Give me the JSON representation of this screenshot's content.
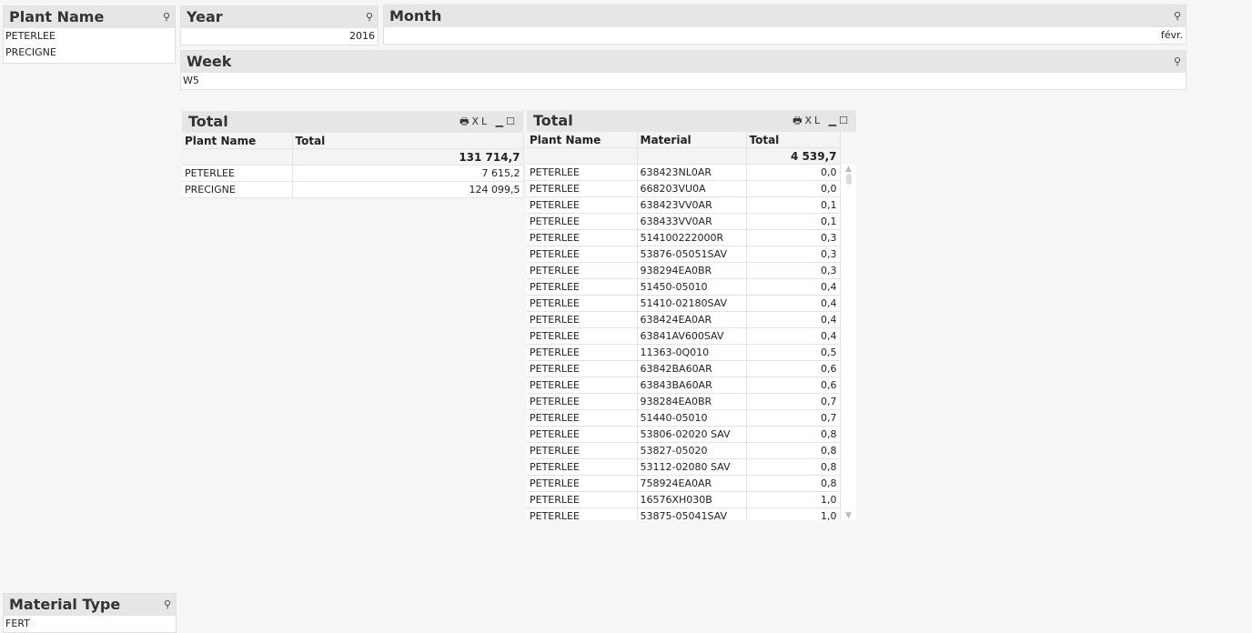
{
  "plant_listbox": {
    "title": "Plant Name",
    "items": [
      "PETERLEE",
      "PRECIGNE"
    ]
  },
  "year_listbox": {
    "title": "Year",
    "value": "2016"
  },
  "month_listbox": {
    "title": "Month",
    "value": "févr."
  },
  "week_listbox": {
    "title": "Week",
    "value": "W5"
  },
  "material_type_listbox": {
    "title": "Material Type",
    "value": "FERT"
  },
  "icons": {
    "search": "search-icon",
    "print": "print-icon",
    "xl": "XL",
    "minimize": "minimize-icon",
    "maximize": "maximize-icon"
  },
  "table1": {
    "title": "Total",
    "columns": [
      "Plant Name",
      "Total"
    ],
    "total": "131 714,7",
    "rows": [
      [
        "PETERLEE",
        "7 615,2"
      ],
      [
        "PRECIGNE",
        "124 099,5"
      ]
    ]
  },
  "table2": {
    "title": "Total",
    "columns": [
      "Plant Name",
      "Material",
      "Total"
    ],
    "total": "4 539,7",
    "rows": [
      [
        "PETERLEE",
        "638423NL0AR",
        "0,0"
      ],
      [
        "PETERLEE",
        "668203VU0A",
        "0,0"
      ],
      [
        "PETERLEE",
        "638423VV0AR",
        "0,1"
      ],
      [
        "PETERLEE",
        "638433VV0AR",
        "0,1"
      ],
      [
        "PETERLEE",
        "514100222000R",
        "0,3"
      ],
      [
        "PETERLEE",
        "53876-05051SAV",
        "0,3"
      ],
      [
        "PETERLEE",
        "938294EA0BR",
        "0,3"
      ],
      [
        "PETERLEE",
        "51450-05010",
        "0,4"
      ],
      [
        "PETERLEE",
        "51410-02180SAV",
        "0,4"
      ],
      [
        "PETERLEE",
        "638424EA0AR",
        "0,4"
      ],
      [
        "PETERLEE",
        "63841AV600SAV",
        "0,4"
      ],
      [
        "PETERLEE",
        "11363-0Q010",
        "0,5"
      ],
      [
        "PETERLEE",
        "63842BA60AR",
        "0,6"
      ],
      [
        "PETERLEE",
        "63843BA60AR",
        "0,6"
      ],
      [
        "PETERLEE",
        "938284EA0BR",
        "0,7"
      ],
      [
        "PETERLEE",
        "51440-05010",
        "0,7"
      ],
      [
        "PETERLEE",
        "53806-02020 SAV",
        "0,8"
      ],
      [
        "PETERLEE",
        "53827-05020",
        "0,8"
      ],
      [
        "PETERLEE",
        "53112-02080 SAV",
        "0,8"
      ],
      [
        "PETERLEE",
        "758924EA0AR",
        "0,8"
      ],
      [
        "PETERLEE",
        "16576XH030B",
        "1,0"
      ],
      [
        "PETERLEE",
        "53875-05041SAV",
        "1,0"
      ]
    ]
  }
}
